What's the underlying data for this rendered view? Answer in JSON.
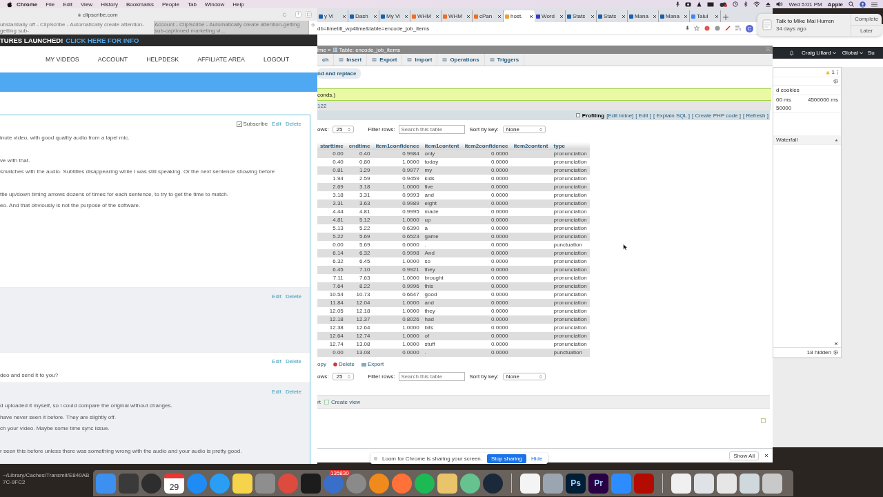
{
  "menubar": {
    "app": "Chrome",
    "menus": [
      "File",
      "Edit",
      "View",
      "History",
      "Bookmarks",
      "People",
      "Tab",
      "Window",
      "Help"
    ],
    "clock": "Wed 5:01 PM",
    "user": "Apple"
  },
  "safari": {
    "url": "clipscribe.com",
    "tabs": [
      {
        "label": "ubstantially off - ClipScribe - Automatically create attention-getting sub-",
        "selected": true
      },
      {
        "label": "Account - ClipScribe - Automatically create attention-getting sub-captioned marketing vi...",
        "selected": false
      }
    ],
    "banner": {
      "text": "TURES LAUNCHED!",
      "link": "CLICK HERE FOR INFO"
    },
    "nav": [
      "MY VIDEOS",
      "ACCOUNT",
      "HELPDESK",
      "AFFILIATE AREA",
      "LOGOUT"
    ],
    "comments": [
      {
        "shaded": false,
        "subscribe": {
          "label": "Subscribe",
          "checked": true
        },
        "actions": [
          "Edit",
          "Delete"
        ],
        "paragraphs": [
          [
            "inute video, with good quality audio from a lapel mic."
          ],
          [
            "ve with that.",
            "smatches with the audio. Subtitles disappearing while I was still speaking. Or the next sentence showing before"
          ],
          [
            "ttle up/down timing arrows dozens of times for each sentence, to try to get the time to match.",
            "eo. And that obviously is not the purpose of the software."
          ]
        ]
      },
      {
        "shaded": true,
        "actions": [
          "Edit",
          "Delete"
        ]
      },
      {
        "shaded": false,
        "actions": [
          "Edit",
          "Delete"
        ],
        "paragraphs": [
          [
            "deo and send it to you?"
          ]
        ]
      },
      {
        "shaded": true,
        "actions": [
          "Edit",
          "Delete"
        ],
        "paragraphs": [
          [
            "d uploaded it myself, so I could compare the original without changes.",
            " have never seen it before. They are slightly off.",
            "ch your video. Maybe some time sync issue."
          ],
          [
            "r seen this before unless there was something wrong with the audio and your audio is pretty good."
          ]
        ]
      }
    ]
  },
  "chrome": {
    "tabs": [
      {
        "label": "y Vi",
        "selected": false
      },
      {
        "label": "Dash",
        "selected": false
      },
      {
        "label": "My Vi",
        "selected": false
      },
      {
        "label": "WHM",
        "selected": false
      },
      {
        "label": "WHM",
        "selected": false
      },
      {
        "label": "cPan",
        "selected": false
      },
      {
        "label": "host.",
        "selected": true
      },
      {
        "label": "Word",
        "selected": false
      },
      {
        "label": "Stats",
        "selected": false
      },
      {
        "label": "Stats",
        "selected": false
      },
      {
        "label": "Mana",
        "selected": false
      },
      {
        "label": "Mana",
        "selected": false
      },
      {
        "label": "Talul",
        "selected": false
      }
    ],
    "url": "db=limetitl_wp4lime&table=encode_job_items",
    "profile_initial": "C",
    "pma": {
      "breadcrumb": "ime »",
      "table_title": "Table: encode_job_items",
      "tabs": [
        "ch",
        "Insert",
        "Export",
        "Import",
        "Operations",
        "Triggers"
      ],
      "find_replace": "nd and replace",
      "message": "conds.)",
      "sql_fragment": "122",
      "profiling": {
        "label": "Profiling",
        "checked": false,
        "links": [
          "[Edit inline]",
          "[ Edit ]",
          "[ Explain SQL ]",
          "[ Create PHP code ]",
          "[ Refresh ]"
        ]
      },
      "controls": [
        {
          "rows_label": "ows:",
          "rows_value": "25",
          "filter_label": "Filter rows:",
          "filter_placeholder": "Search this table",
          "sort_label": "Sort by key:",
          "sort_value": "None"
        },
        {
          "rows_label": "ows:",
          "rows_value": "25",
          "filter_label": "Filter rows:",
          "filter_placeholder": "Search this table",
          "sort_label": "Sort by key:",
          "sort_value": "None"
        }
      ],
      "table": {
        "columns": [
          {
            "label": "starttime",
            "kind": "number"
          },
          {
            "label": "endtime",
            "kind": "number"
          },
          {
            "label": "item1confidence",
            "kind": "number"
          },
          {
            "label": "item1content",
            "kind": "text"
          },
          {
            "label": "item2confidence",
            "kind": "number"
          },
          {
            "label": "item2content",
            "kind": "empty"
          },
          {
            "label": "type",
            "kind": "text"
          }
        ],
        "rows": [
          [
            "0.00",
            "0.40",
            "0.9984",
            "only",
            "0.0000",
            "pronunciation"
          ],
          [
            "0.40",
            "0.80",
            "1.0000",
            "today",
            "0.0000",
            "pronunciation"
          ],
          [
            "0.81",
            "1.29",
            "0.9977",
            "my",
            "0.0000",
            "pronunciation"
          ],
          [
            "1.94",
            "2.59",
            "0.9459",
            "kids",
            "0.0000",
            "pronunciation"
          ],
          [
            "2.69",
            "3.18",
            "1.0000",
            "five",
            "0.0000",
            "pronunciation"
          ],
          [
            "3.18",
            "3.31",
            "0.9993",
            "and",
            "0.0000",
            "pronunciation"
          ],
          [
            "3.31",
            "3.63",
            "0.9989",
            "eight",
            "0.0000",
            "pronunciation"
          ],
          [
            "4.44",
            "4.81",
            "0.9995",
            "made",
            "0.0000",
            "pronunciation"
          ],
          [
            "4.81",
            "5.12",
            "1.0000",
            "up",
            "0.0000",
            "pronunciation"
          ],
          [
            "5.13",
            "5.22",
            "0.6390",
            "a",
            "0.0000",
            "pronunciation"
          ],
          [
            "5.22",
            "5.69",
            "0.6523",
            "game",
            "0.0000",
            "pronunciation"
          ],
          [
            "0.00",
            "5.69",
            "0.0000",
            ".",
            "0.0000",
            "punctuation"
          ],
          [
            "6.14",
            "6.32",
            "0.9998",
            "And",
            "0.0000",
            "pronunciation"
          ],
          [
            "6.32",
            "6.45",
            "1.0000",
            "so",
            "0.0000",
            "pronunciation"
          ],
          [
            "6.45",
            "7.10",
            "0.9921",
            "they",
            "0.0000",
            "pronunciation"
          ],
          [
            "7.11",
            "7.63",
            "1.0000",
            "brought",
            "0.0000",
            "pronunciation"
          ],
          [
            "7.64",
            "8.22",
            "0.9996",
            "this",
            "0.0000",
            "pronunciation"
          ],
          [
            "10.54",
            "10.73",
            "0.6647",
            "good",
            "0.0000",
            "pronunciation"
          ],
          [
            "11.84",
            "12.04",
            "1.0000",
            "and",
            "0.0000",
            "pronunciation"
          ],
          [
            "12.05",
            "12.18",
            "1.0000",
            "they",
            "0.0000",
            "pronunciation"
          ],
          [
            "12.18",
            "12.37",
            "0.8026",
            "had",
            "0.0000",
            "pronunciation"
          ],
          [
            "12.38",
            "12.64",
            "1.0000",
            "bits",
            "0.0000",
            "pronunciation"
          ],
          [
            "12.64",
            "12.74",
            "1.0000",
            "of",
            "0.0000",
            "pronunciation"
          ],
          [
            "12.74",
            "13.08",
            "1.0000",
            "stuff",
            "0.0000",
            "pronunciation"
          ],
          [
            "0.00",
            "13.08",
            "0.0000",
            ".",
            "0.0000",
            "punctuation"
          ]
        ]
      },
      "row_actions": [
        "opy",
        "Delete",
        "Export"
      ],
      "bottom_actions": [
        "rt",
        "Create view"
      ]
    },
    "downloads": {
      "show_all": "Show All"
    }
  },
  "side": {
    "user": "Craig Lillard",
    "region": "Global",
    "cut_item": "Su",
    "warnings": "1",
    "cookies": "d cookies",
    "ticks": [
      "00 ms",
      "4500000 ms",
      "50000"
    ],
    "waterfall": "Waterfall",
    "hidden": "18 hidden"
  },
  "notification": {
    "title": "Talk to Mike Mai Hurren",
    "time": "34 days ago",
    "actions": [
      "Complete",
      "Later"
    ]
  },
  "loom": {
    "text": "Loom for Chrome is sharing your screen.",
    "stop": "Stop sharing",
    "hide": "Hide"
  },
  "terminal": {
    "path": "~/Library/Caches/Transmit/E840AB7C-9FC2"
  },
  "dock": {
    "items": [
      {
        "kind": "tile",
        "color": "#3d8ff0"
      },
      {
        "kind": "tile",
        "color": "#3a3a3a"
      },
      {
        "kind": "round",
        "color": "#2e2e2e"
      },
      {
        "kind": "calendar",
        "color": "#ffffff",
        "day": "29"
      },
      {
        "kind": "round",
        "color": "#1f8cf5"
      },
      {
        "kind": "round",
        "color": "#2a9df4"
      },
      {
        "kind": "tile",
        "color": "#f5d44c"
      },
      {
        "kind": "tile",
        "color": "#8e8e8e"
      },
      {
        "kind": "round",
        "color": "#dd4b3e"
      },
      {
        "kind": "tile",
        "color": "#1c1c1c"
      },
      {
        "kind": "round",
        "color": "#3a6fc9",
        "badge": "135830"
      },
      {
        "kind": "round",
        "color": "#8a8a8a"
      },
      {
        "kind": "round",
        "color": "#f08a1c"
      },
      {
        "kind": "round",
        "color": "#ff7139"
      },
      {
        "kind": "round",
        "color": "#1db954"
      },
      {
        "kind": "tile",
        "color": "#e9c46a"
      },
      {
        "kind": "round",
        "color": "#66c28f"
      },
      {
        "kind": "round",
        "color": "#1a2a3a"
      },
      {
        "kind": "separator"
      },
      {
        "kind": "tile",
        "color": "#f4f4f4"
      },
      {
        "kind": "tile",
        "color": "#9aa5b1"
      },
      {
        "kind": "label",
        "color": "#001e36",
        "label": "Ps"
      },
      {
        "kind": "label",
        "color": "#2a0045",
        "label": "Pr"
      },
      {
        "kind": "tile",
        "color": "#2d8cff"
      },
      {
        "kind": "tile",
        "color": "#b30b00"
      },
      {
        "kind": "separator"
      },
      {
        "kind": "tile",
        "color": "#f0f0f0"
      },
      {
        "kind": "tile",
        "color": "#dfe3e8"
      },
      {
        "kind": "tile",
        "color": "#e6e6e6"
      },
      {
        "kind": "tile",
        "color": "#cfd8dc"
      },
      {
        "kind": "tile",
        "color": "#c9c9c9"
      }
    ]
  }
}
